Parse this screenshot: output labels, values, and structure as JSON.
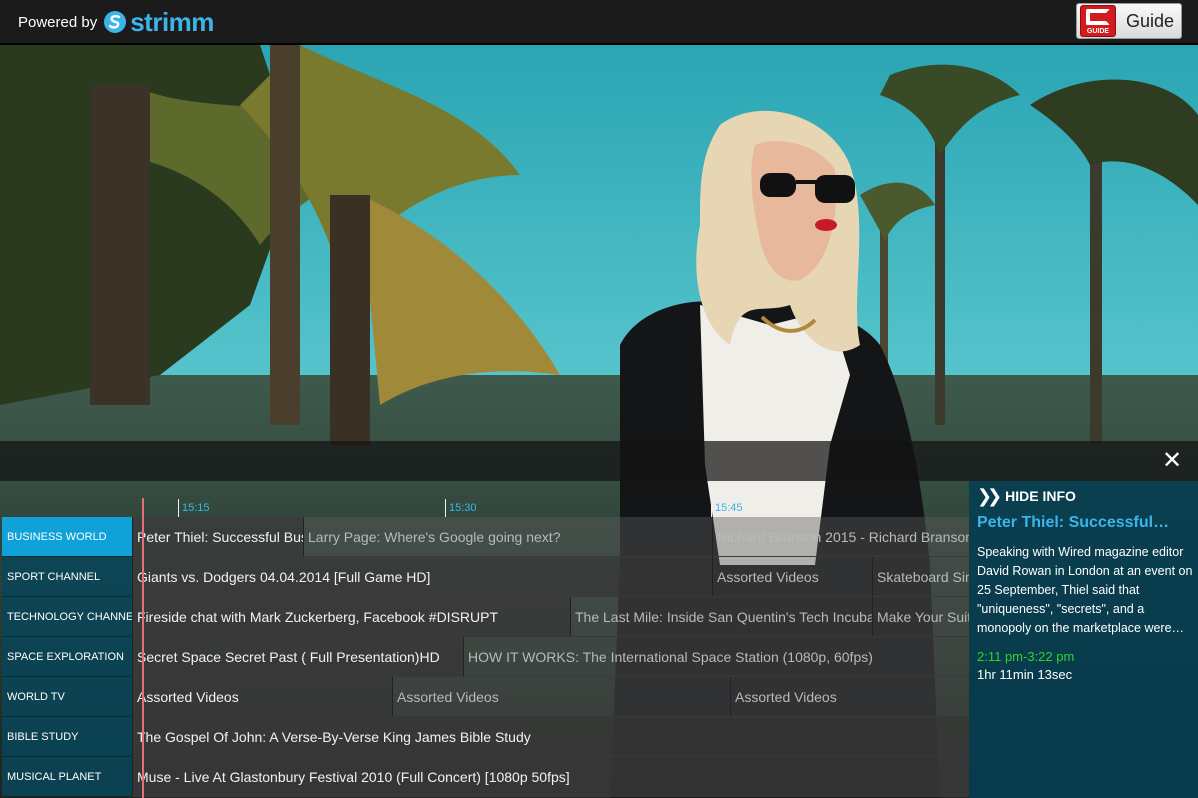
{
  "header": {
    "powered_by": "Powered by",
    "brand": "strimm",
    "guide_icon_text": "GUIDE",
    "guide_label": "Guide"
  },
  "colors": {
    "accent": "#3cb4ea",
    "active_channel": "#0fa2d8",
    "time_green": "#34d32b",
    "now_line": "#e0707a"
  },
  "icons": {
    "close": "close-icon",
    "hide_info": "double-chevron-right-icon",
    "guide": "guide-icon",
    "logo": "strimm-logo-icon"
  },
  "epg": {
    "times": [
      "15:15",
      "15:30",
      "15:45"
    ],
    "rows": [
      {
        "channel": "BUSINESS WORLD",
        "active": true,
        "programs": [
          "Peter Thiel: Successful Bus",
          "Larry Page: Where's Google going next?",
          "Richard Branson 2015 - Richard Branson"
        ]
      },
      {
        "channel": "SPORT CHANNEL",
        "programs": [
          "Giants vs. Dodgers 04.04.2014 [Full Game HD]",
          "Assorted Videos",
          "Skateboard Sin"
        ]
      },
      {
        "channel": "TECHNOLOGY CHANNEL",
        "programs": [
          "Fireside chat with Mark Zuckerberg, Facebook #DISRUPT",
          "The Last Mile: Inside San Quentin's Tech Incubat",
          "Make Your Suit"
        ]
      },
      {
        "channel": "SPACE EXPLORATION",
        "programs": [
          "Secret Space Secret Past ( Full Presentation)HD",
          "HOW IT WORKS: The International Space Station (1080p, 60fps)"
        ]
      },
      {
        "channel": "WORLD TV",
        "programs": [
          "Assorted Videos",
          "Assorted Videos",
          "Assorted Videos"
        ]
      },
      {
        "channel": "BIBLE STUDY",
        "programs": [
          "The Gospel Of John: A Verse-By-Verse King James Bible Study"
        ]
      },
      {
        "channel": "MUSICAL PLANET",
        "programs": [
          "Muse - Live At Glastonbury Festival 2010 (Full Concert) [1080p 50fps]"
        ]
      }
    ]
  },
  "info_panel": {
    "hide_label": "HIDE INFO",
    "title": "Peter Thiel: Successful…",
    "description": "Speaking with Wired magazine editor David Rowan in London at an event on 25 September, Thiel said that \"uniqueness\", \"secrets\", and a monopoly on the marketplace were…",
    "time_range": "2:11 pm-3:22 pm",
    "duration": "1hr 11min 13sec"
  }
}
